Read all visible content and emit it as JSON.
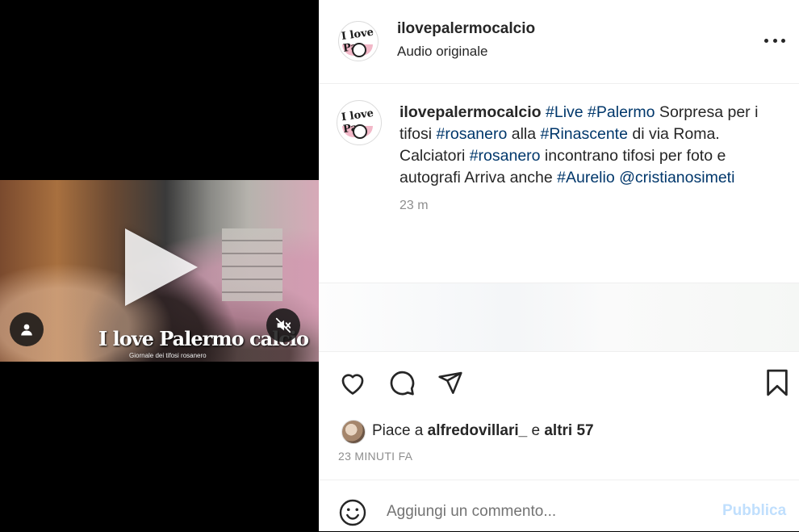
{
  "post": {
    "username": "ilovepalermocalcio",
    "audio_label": "Audio originale",
    "video_watermark": "I love Palermo calcio",
    "video_watermark_sub": "Giornale dei tifosi rosanero"
  },
  "caption": {
    "username": "ilovepalermocalcio",
    "parts": [
      {
        "type": "tag",
        "text": "#Live"
      },
      {
        "type": "text",
        "text": " "
      },
      {
        "type": "tag",
        "text": "#Palermo"
      },
      {
        "type": "text",
        "text": " Sorpresa per i tifosi "
      },
      {
        "type": "tag",
        "text": "#rosanero"
      },
      {
        "type": "text",
        "text": " alla "
      },
      {
        "type": "tag",
        "text": "#Rinascente"
      },
      {
        "type": "text",
        "text": " di via Roma. Calciatori "
      },
      {
        "type": "tag",
        "text": "#rosanero"
      },
      {
        "type": "text",
        "text": " incontrano tifosi per foto e autografi Arriva anche "
      },
      {
        "type": "tag",
        "text": "#Aurelio"
      },
      {
        "type": "text",
        "text": " "
      },
      {
        "type": "tag",
        "text": "@cristianosimeti"
      }
    ],
    "time": "23 m"
  },
  "likes": {
    "prefix": "Piace a",
    "user": "alfredovillari_",
    "joiner": "e",
    "others": "altri 57"
  },
  "post_age": "23 MINUTI FA",
  "comment": {
    "placeholder": "Aggiungi un commento...",
    "publish_label": "Pubblica"
  },
  "colors": {
    "hashtag": "#00376b",
    "publish_disabled": "#c0dffd",
    "muted_text": "#8e8e8e"
  },
  "icons": [
    "heart-icon",
    "comment-icon",
    "share-icon",
    "bookmark-icon",
    "more-icon",
    "emoji-icon",
    "user-tag-icon",
    "mute-icon",
    "play-icon"
  ]
}
